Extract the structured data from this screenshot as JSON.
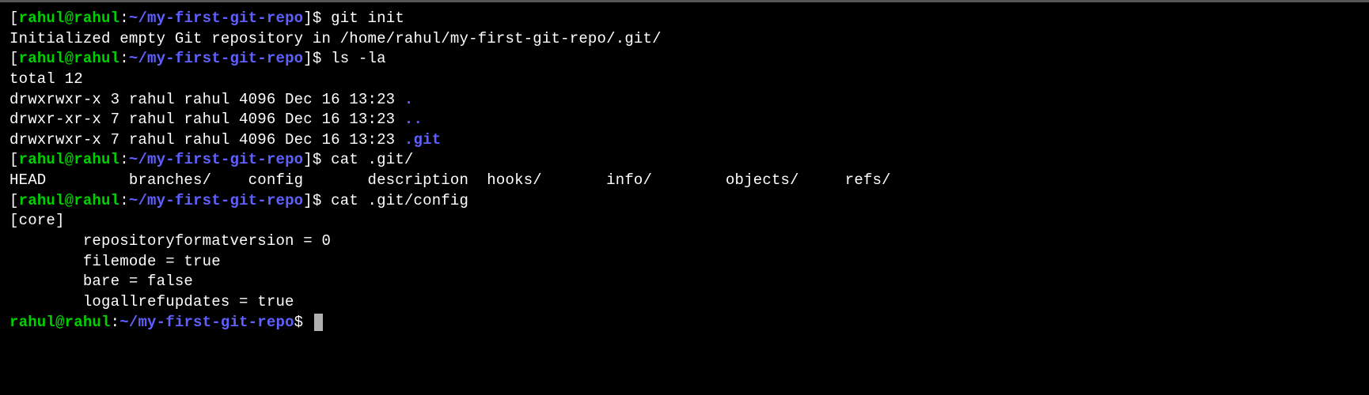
{
  "prompt1": {
    "open": "[",
    "userhost": "rahul@rahul",
    "colon": ":",
    "path": "~/my-first-git-repo",
    "close": "$ ",
    "cmd": "git init"
  },
  "out1": "Initialized empty Git repository in /home/rahul/my-first-git-repo/.git/",
  "prompt2": {
    "open": "[",
    "userhost": "rahul@rahul",
    "colon": ":",
    "path": "~/my-first-git-repo",
    "close": "$ ",
    "cmd": "ls -la"
  },
  "ls": {
    "total": "total 12",
    "r1_pre": "drwxrwxr-x 3 rahul rahul 4096 Dec 16 13:23 ",
    "r1_dir": ".",
    "r2_pre": "drwxr-xr-x 7 rahul rahul 4096 Dec 16 13:23 ",
    "r2_dir": "..",
    "r3_pre": "drwxrwxr-x 7 rahul rahul 4096 Dec 16 13:23 ",
    "r3_dir": ".git"
  },
  "prompt3": {
    "open": "[",
    "userhost": "rahul@rahul",
    "colon": ":",
    "path": "~/my-first-git-repo",
    "close": "$ ",
    "cmd": "cat .git/"
  },
  "tabcomp": "HEAD         branches/    config       description  hooks/       info/        objects/     refs/",
  "prompt4": {
    "open": "[",
    "userhost": "rahul@rahul",
    "colon": ":",
    "path": "~/my-first-git-repo",
    "close": "$ ",
    "cmd": "cat .git/config"
  },
  "config": {
    "section": "[core]",
    "l1": "        repositoryformatversion = 0",
    "l2": "        filemode = true",
    "l3": "        bare = false",
    "l4": "        logallrefupdates = true"
  },
  "prompt5": {
    "userhost": "rahul@rahul",
    "colon": ":",
    "path": "~/my-first-git-repo",
    "close": "$ "
  }
}
